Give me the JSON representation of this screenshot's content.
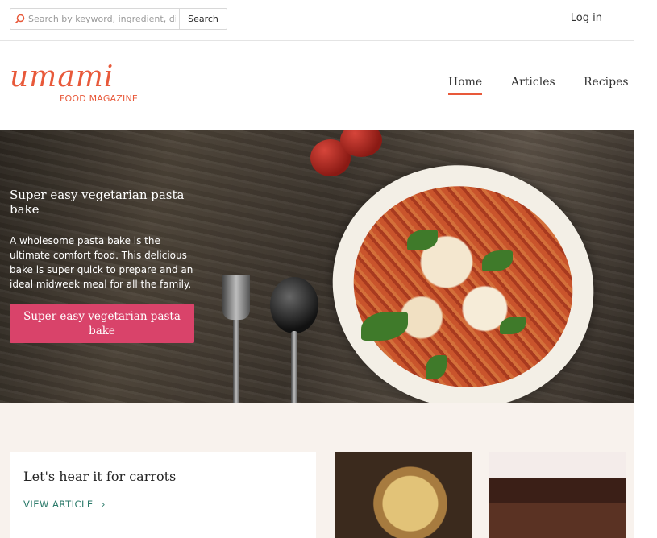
{
  "search": {
    "placeholder": "Search by keyword, ingredient, dish",
    "button_label": "Search"
  },
  "header": {
    "login_label": "Log in"
  },
  "logo": {
    "wordmark": "umami",
    "tagline": "FOOD MAGAZINE"
  },
  "nav": {
    "items": [
      {
        "label": "Home",
        "active": true
      },
      {
        "label": "Articles"
      },
      {
        "label": "Recipes"
      }
    ]
  },
  "hero": {
    "title": "Super easy vegetarian pasta bake",
    "description": "A wholesome pasta bake is the ultimate comfort food. This delicious bake is super quick to prepare and an ideal midweek meal for all the family.",
    "button_label": "Super easy vegetarian pasta bake"
  },
  "featured": {
    "title": "Let's hear it for carrots",
    "link_label": "VIEW ARTICLE"
  },
  "colors": {
    "brand": "#e8593a",
    "cta": "#d9436a",
    "link": "#2b7a6a"
  }
}
